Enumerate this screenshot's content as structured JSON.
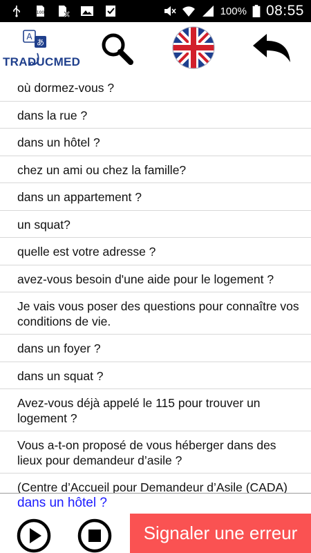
{
  "status_bar": {
    "battery_percent": "100%",
    "time": "08:55"
  },
  "header": {
    "logo_text": "TRADUCMED",
    "logo_badge_a": "A",
    "logo_badge_b": "あ",
    "language_flag": "uk-flag"
  },
  "phrases": [
    "où dormez-vous ?",
    "dans la rue ?",
    "dans un hôtel ?",
    "chez un ami ou chez la famille?",
    "dans un appartement ?",
    "un squat?",
    "quelle est votre adresse ?",
    "avez-vous besoin d'une aide pour le logement ?",
    "Je vais vous poser des questions pour connaître vos conditions de vie.",
    "dans un foyer ?",
    "dans un squat ?",
    "Avez-vous déjà appelé le 115 pour trouver un logement ?",
    "Vous a-t-on proposé de vous héberger dans des lieux pour demandeur d’asile ?",
    "(Centre d’Accueil pour Demandeur d’Asile (CADA)"
  ],
  "selected_phrase": "dans un hôtel ?",
  "bottom_bar": {
    "report_button_label": "Signaler une erreur"
  },
  "colors": {
    "status_bar_bg": "#000000",
    "selected_text": "#1a1aff",
    "report_button_bg": "#fa5252",
    "logo_blue": "#1f3f8c"
  }
}
